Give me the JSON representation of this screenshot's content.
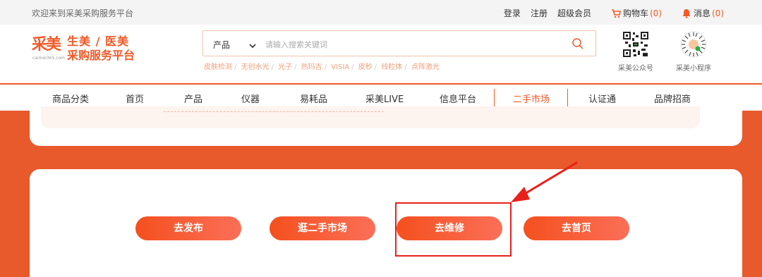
{
  "topbar": {
    "welcome": "欢迎来到采美采购服务平台",
    "login": "登录",
    "register": "注册",
    "vip": "超级会员",
    "cart_label": "购物车",
    "cart_count": "(0)",
    "msg_label": "消息",
    "msg_count": "(0)"
  },
  "logo": {
    "mark": "采美",
    "mark_sub": "caimei365.com",
    "line1": "生美 / 医美",
    "line2": "采购服务平台"
  },
  "search": {
    "category": "产品",
    "placeholder": "请输入搜索关键词"
  },
  "hot_keywords": [
    "皮肤检测",
    "无创水光",
    "光子",
    "热玛吉",
    "VISIA",
    "皮秒",
    "线粒体",
    "点阵激光"
  ],
  "qr": {
    "official": "采美公众号",
    "mini": "采美小程序"
  },
  "nav": {
    "items": [
      "商品分类",
      "首页",
      "产品",
      "仪器",
      "易耗品",
      "采美LIVE",
      "信息平台",
      "二手市场",
      "认证通",
      "品牌招商"
    ],
    "active": "二手市场"
  },
  "actions": {
    "publish": "去发布",
    "browse": "逛二手市场",
    "repair": "去维修",
    "home": "去首页"
  },
  "colors": {
    "accent": "#f05a28",
    "annotation": "#e8201a"
  }
}
